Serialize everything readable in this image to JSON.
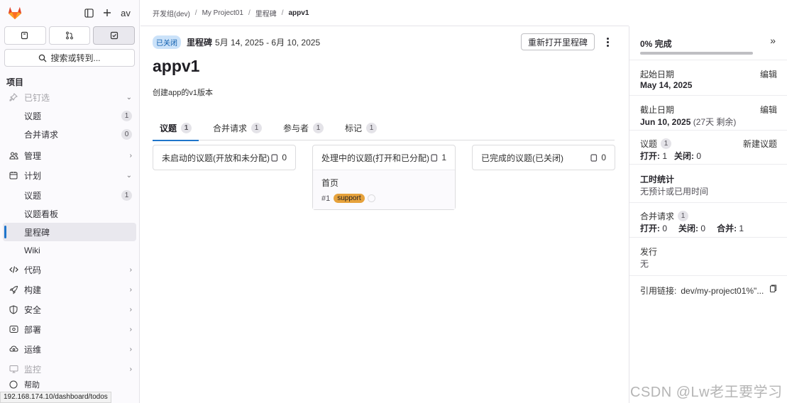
{
  "sidebar": {
    "avatar": "av",
    "search_label": "搜索或转到...",
    "section_title": "项目",
    "items": [
      {
        "label": "已钉选",
        "faded": true
      },
      {
        "label": "议题",
        "count": "1"
      },
      {
        "label": "合并请求",
        "count": "0"
      },
      {
        "label": "管理"
      },
      {
        "label": "计划"
      },
      {
        "label": "议题",
        "count": "1"
      },
      {
        "label": "议题看板"
      },
      {
        "label": "里程碑"
      },
      {
        "label": "Wiki"
      },
      {
        "label": "代码"
      },
      {
        "label": "构建"
      },
      {
        "label": "安全"
      },
      {
        "label": "部署"
      },
      {
        "label": "运维"
      },
      {
        "label": "监控",
        "faded": true
      },
      {
        "label": "帮助"
      }
    ],
    "status_url": "192.168.174.10/dashboard/todos"
  },
  "breadcrumb": [
    "开发组(dev)",
    "My Project01",
    "里程碑",
    "appv1"
  ],
  "milestone": {
    "status": "已关闭",
    "label": "里程碑",
    "dates": "5月 14, 2025 - 6月 10, 2025",
    "reopen_button": "重新打开里程碑",
    "title": "appv1",
    "description": "创建app的v1版本"
  },
  "tabs": [
    {
      "label": "议题",
      "count": "1"
    },
    {
      "label": "合并请求",
      "count": "1"
    },
    {
      "label": "参与者",
      "count": "1"
    },
    {
      "label": "标记",
      "count": "1"
    }
  ],
  "boards": [
    {
      "title": "未启动的议题(开放和未分配)",
      "count": "0"
    },
    {
      "title": "处理中的议题(打开和已分配)",
      "count": "1",
      "card": {
        "title": "首页",
        "ref": "#1",
        "label": "support"
      }
    },
    {
      "title": "已完成的议题(已关闭)",
      "count": "0"
    }
  ],
  "right_panel": {
    "progress_text": "0% 完成",
    "progress_fraction": 0,
    "start_label": "起始日期",
    "start_value": "May 14, 2025",
    "due_label": "截止日期",
    "due_value": "Jun 10, 2025",
    "due_remaining": "(27天 剩余)",
    "edit": "编辑",
    "issues_label": "议题",
    "issues_count": "1",
    "new_issue": "新建议题",
    "open_label": "打开:",
    "open_value": "1",
    "closed_label": "关闭:",
    "closed_value": "0",
    "time_title": "工时统计",
    "time_value": "无预计或已用时间",
    "mr_label": "合并请求",
    "mr_count": "1",
    "mr_open_value": "0",
    "mr_closed_value": "0",
    "merged_label": "合并:",
    "merged_value": "1",
    "release_label": "发行",
    "release_value": "无",
    "ref_label": "引用链接:",
    "ref_value": "dev/my-project01%\"..."
  },
  "watermark": "CSDN @Lw老王要学习",
  "colors": {
    "accent": "#1f75cb",
    "label_support": "#e6a23c",
    "status_closed_bg": "#cbe2f9"
  }
}
